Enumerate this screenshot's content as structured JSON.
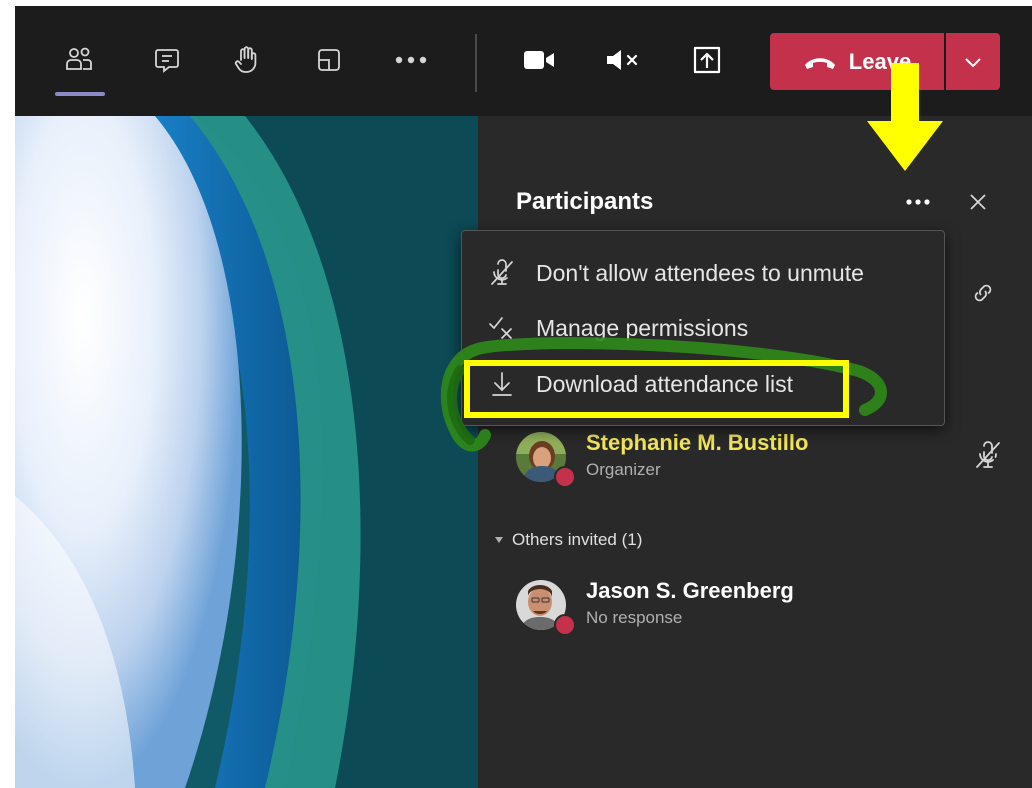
{
  "toolbar": {
    "buttons": [
      {
        "name": "participants",
        "icon": "people-icon"
      },
      {
        "name": "chat",
        "icon": "chat-icon"
      },
      {
        "name": "raise-hand",
        "icon": "hand-icon"
      },
      {
        "name": "rooms",
        "icon": "breakout-rooms-icon"
      },
      {
        "name": "more",
        "icon": "more-horizontal-icon"
      },
      {
        "name": "camera",
        "icon": "video-camera-icon"
      },
      {
        "name": "speaker",
        "icon": "speaker-muted-icon"
      },
      {
        "name": "share",
        "icon": "share-tray-icon"
      }
    ],
    "leave_label": "Leave",
    "leave_color": "#c4314b",
    "active_indicator_color": "#8b8cc7"
  },
  "panel": {
    "title": "Participants",
    "more_icon": "more-horizontal-icon",
    "close_icon": "close-icon",
    "link_icon": "link-icon"
  },
  "menu": {
    "items": [
      {
        "label": "Don't allow attendees to unmute",
        "icon": "mic-off-icon"
      },
      {
        "label": "Manage permissions",
        "icon": "check-x-icon"
      },
      {
        "label": "Download attendance list",
        "icon": "download-icon"
      }
    ]
  },
  "participants": {
    "organizer": {
      "name": "Stephanie M. Bustillo",
      "role": "Organizer",
      "name_color": "#f1e55a"
    },
    "group_label": "Others invited (1)",
    "invited": [
      {
        "name": "Jason S. Greenberg",
        "status": "No response"
      }
    ]
  },
  "annotations": {
    "arrow_color": "#ffff00",
    "highlight_color": "#ffff00",
    "scribble_color": "#2f8a1a"
  }
}
